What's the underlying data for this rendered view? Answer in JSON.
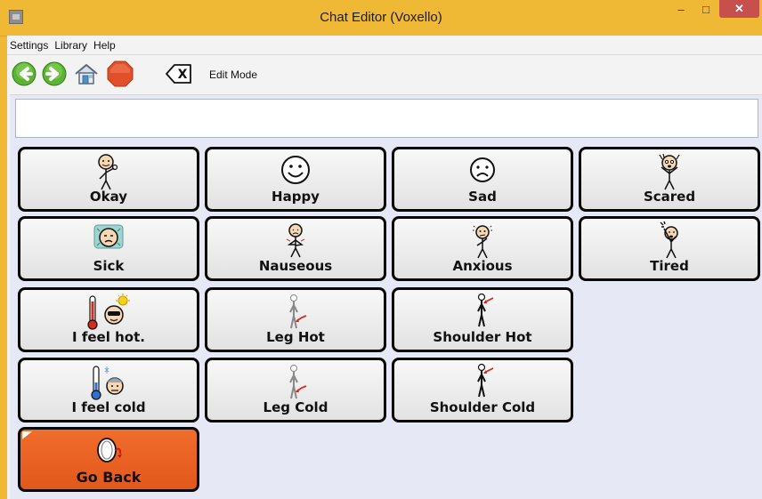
{
  "window": {
    "title": "Chat Editor (Voxello)",
    "controls": {
      "minimize": "–",
      "maximize": "□",
      "close": "✕"
    }
  },
  "menu": {
    "items": [
      "Settings",
      "Library",
      "Help"
    ]
  },
  "toolbar": {
    "buttons": [
      "back-arrow",
      "forward-arrow",
      "home",
      "stop",
      "clear"
    ],
    "clear_glyph": "X",
    "edit_mode_label": "Edit Mode"
  },
  "message": {
    "value": ""
  },
  "tiles": [
    {
      "label": "Okay",
      "icon": "okay-person-icon"
    },
    {
      "label": "Happy",
      "icon": "happy-face-icon"
    },
    {
      "label": "Sad",
      "icon": "sad-face-icon"
    },
    {
      "label": "Scared",
      "icon": "scared-person-icon"
    },
    {
      "label": "Sick",
      "icon": "sick-face-icon"
    },
    {
      "label": "Nauseous",
      "icon": "nauseous-person-icon"
    },
    {
      "label": "Anxious",
      "icon": "anxious-person-icon"
    },
    {
      "label": "Tired",
      "icon": "tired-person-icon"
    },
    {
      "label": "I feel hot.",
      "icon": "hot-thermometer-icon"
    },
    {
      "label": "Leg Hot",
      "icon": "leg-hot-icon"
    },
    {
      "label": "Shoulder Hot",
      "icon": "shoulder-hot-icon"
    },
    {
      "label": "I feel cold",
      "icon": "cold-thermometer-icon"
    },
    {
      "label": "Leg Cold",
      "icon": "leg-cold-icon"
    },
    {
      "label": "Shoulder Cold",
      "icon": "shoulder-cold-icon"
    },
    {
      "label": "Go Back",
      "icon": "go-back-icon"
    }
  ],
  "colors": {
    "titlebar": "#f0b935",
    "go_back_tile": "#e9601f",
    "close_button": "#c7504c",
    "panel_bg": "#e7e8f6"
  }
}
